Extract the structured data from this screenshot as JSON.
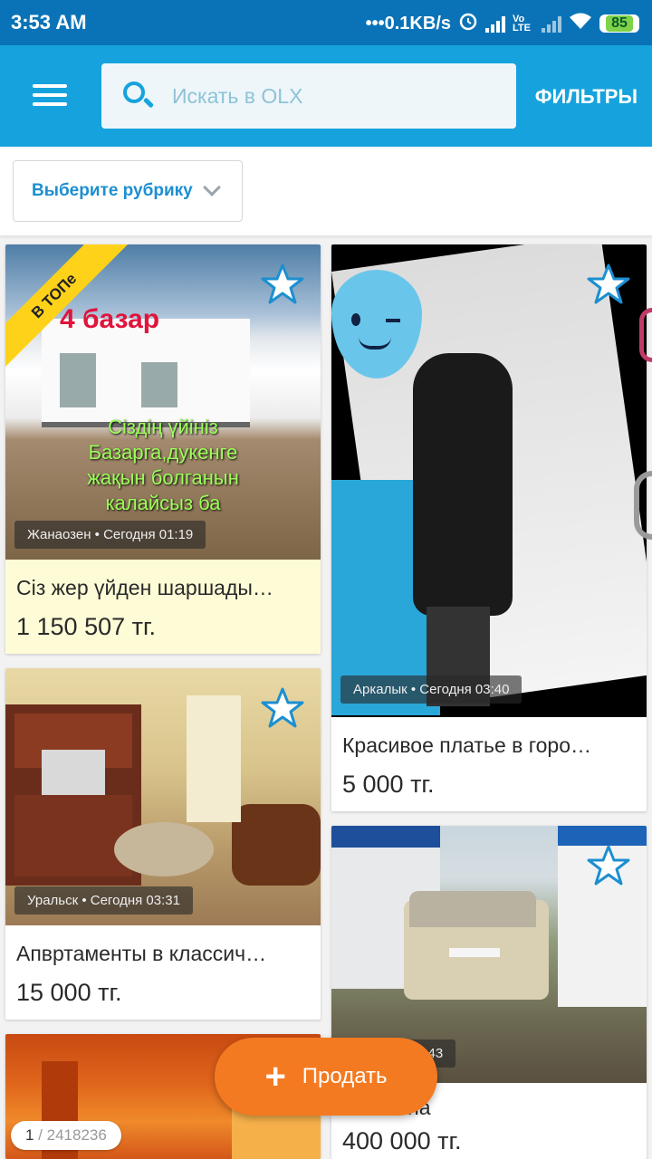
{
  "status_bar": {
    "time": "3:53 AM",
    "net_speed": "•••0.1KB/s",
    "lte": "Vo LTE",
    "battery": "85"
  },
  "app_bar": {
    "search_placeholder": "Искать в OLX",
    "filters_label": "ФИЛЬТРЫ"
  },
  "category": {
    "label": "Выберите рубрику"
  },
  "listings": [
    {
      "badge": "В ТОПе",
      "location": "Жанаозен • Сегодня 01:19",
      "title": "Сіз жер үйден шаршады…",
      "price": "1 150 507 тг.",
      "image_text": [
        "4 базар",
        "Сіздің үйініз",
        "Базарга,дукенге",
        "жақын болганын",
        "калайсыз ба"
      ]
    },
    {
      "location": "Аркалык • Сегодня 03:40",
      "title": "Красивое платье в горо…",
      "price": "5 000 тг."
    },
    {
      "location": "Уральск • Сегодня 03:31",
      "title": "Апвртаменты в классич…",
      "price": "15 000 тг."
    },
    {
      "location": "Сегодня 03:43",
      "title": "на",
      "price": "400 000 тг."
    }
  ],
  "fab": {
    "label": "Продать"
  },
  "pager": {
    "current": "1",
    "total": "/ 2418236"
  },
  "colors": {
    "status_bar": "#0a73b7",
    "app_bar": "#16a3dd",
    "accent": "#1c8fd0",
    "fab": "#f47a21",
    "top_badge": "#ffd21a"
  }
}
